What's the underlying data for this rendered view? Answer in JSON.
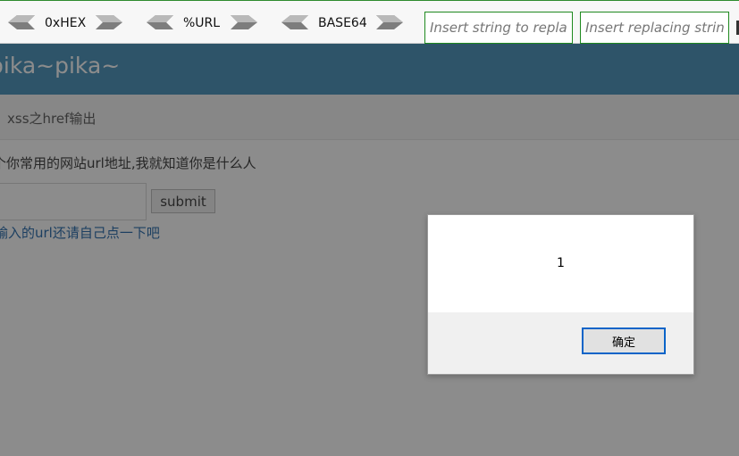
{
  "hackbar": {
    "buttons": [
      {
        "label": "0xHEX"
      },
      {
        "label": "%URL"
      },
      {
        "label": "BASE64"
      }
    ],
    "replace_find_placeholder": "Insert string to replace",
    "replace_with_placeholder": "Insert replacing string"
  },
  "page": {
    "brand": "pika~pika~",
    "breadcrumb": "xss之href输出",
    "prompt": "个你常用的网站url地址,我就知道你是什么人",
    "submit_label": "submit",
    "result_link": "输入的url还请自己点一下吧"
  },
  "dialog": {
    "message": "1",
    "ok_label": "确定"
  },
  "colors": {
    "banner": "#438eb9",
    "hackbar_border": "#2e8b2e",
    "link": "#1e64a8",
    "dialog_button_border": "#0a64c8"
  }
}
